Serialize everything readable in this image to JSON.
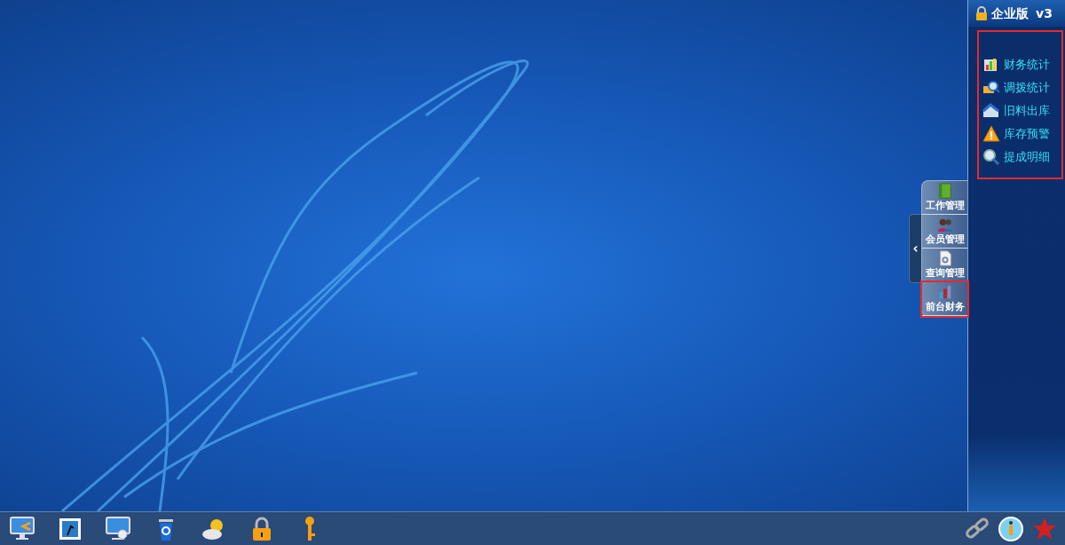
{
  "panel": {
    "title": "企业版",
    "version": "v3",
    "highlighted": true,
    "items": [
      {
        "label": "财务统计"
      },
      {
        "label": "调拨统计"
      },
      {
        "label": "旧料出库"
      },
      {
        "label": "库存预警"
      },
      {
        "label": "提成明细"
      }
    ]
  },
  "side_dock": {
    "toggle": "‹",
    "items": [
      {
        "label": "工作管理",
        "highlighted": false
      },
      {
        "label": "会员管理",
        "highlighted": false
      },
      {
        "label": "查询管理",
        "highlighted": false
      },
      {
        "label": "前台财务",
        "highlighted": true
      }
    ]
  }
}
